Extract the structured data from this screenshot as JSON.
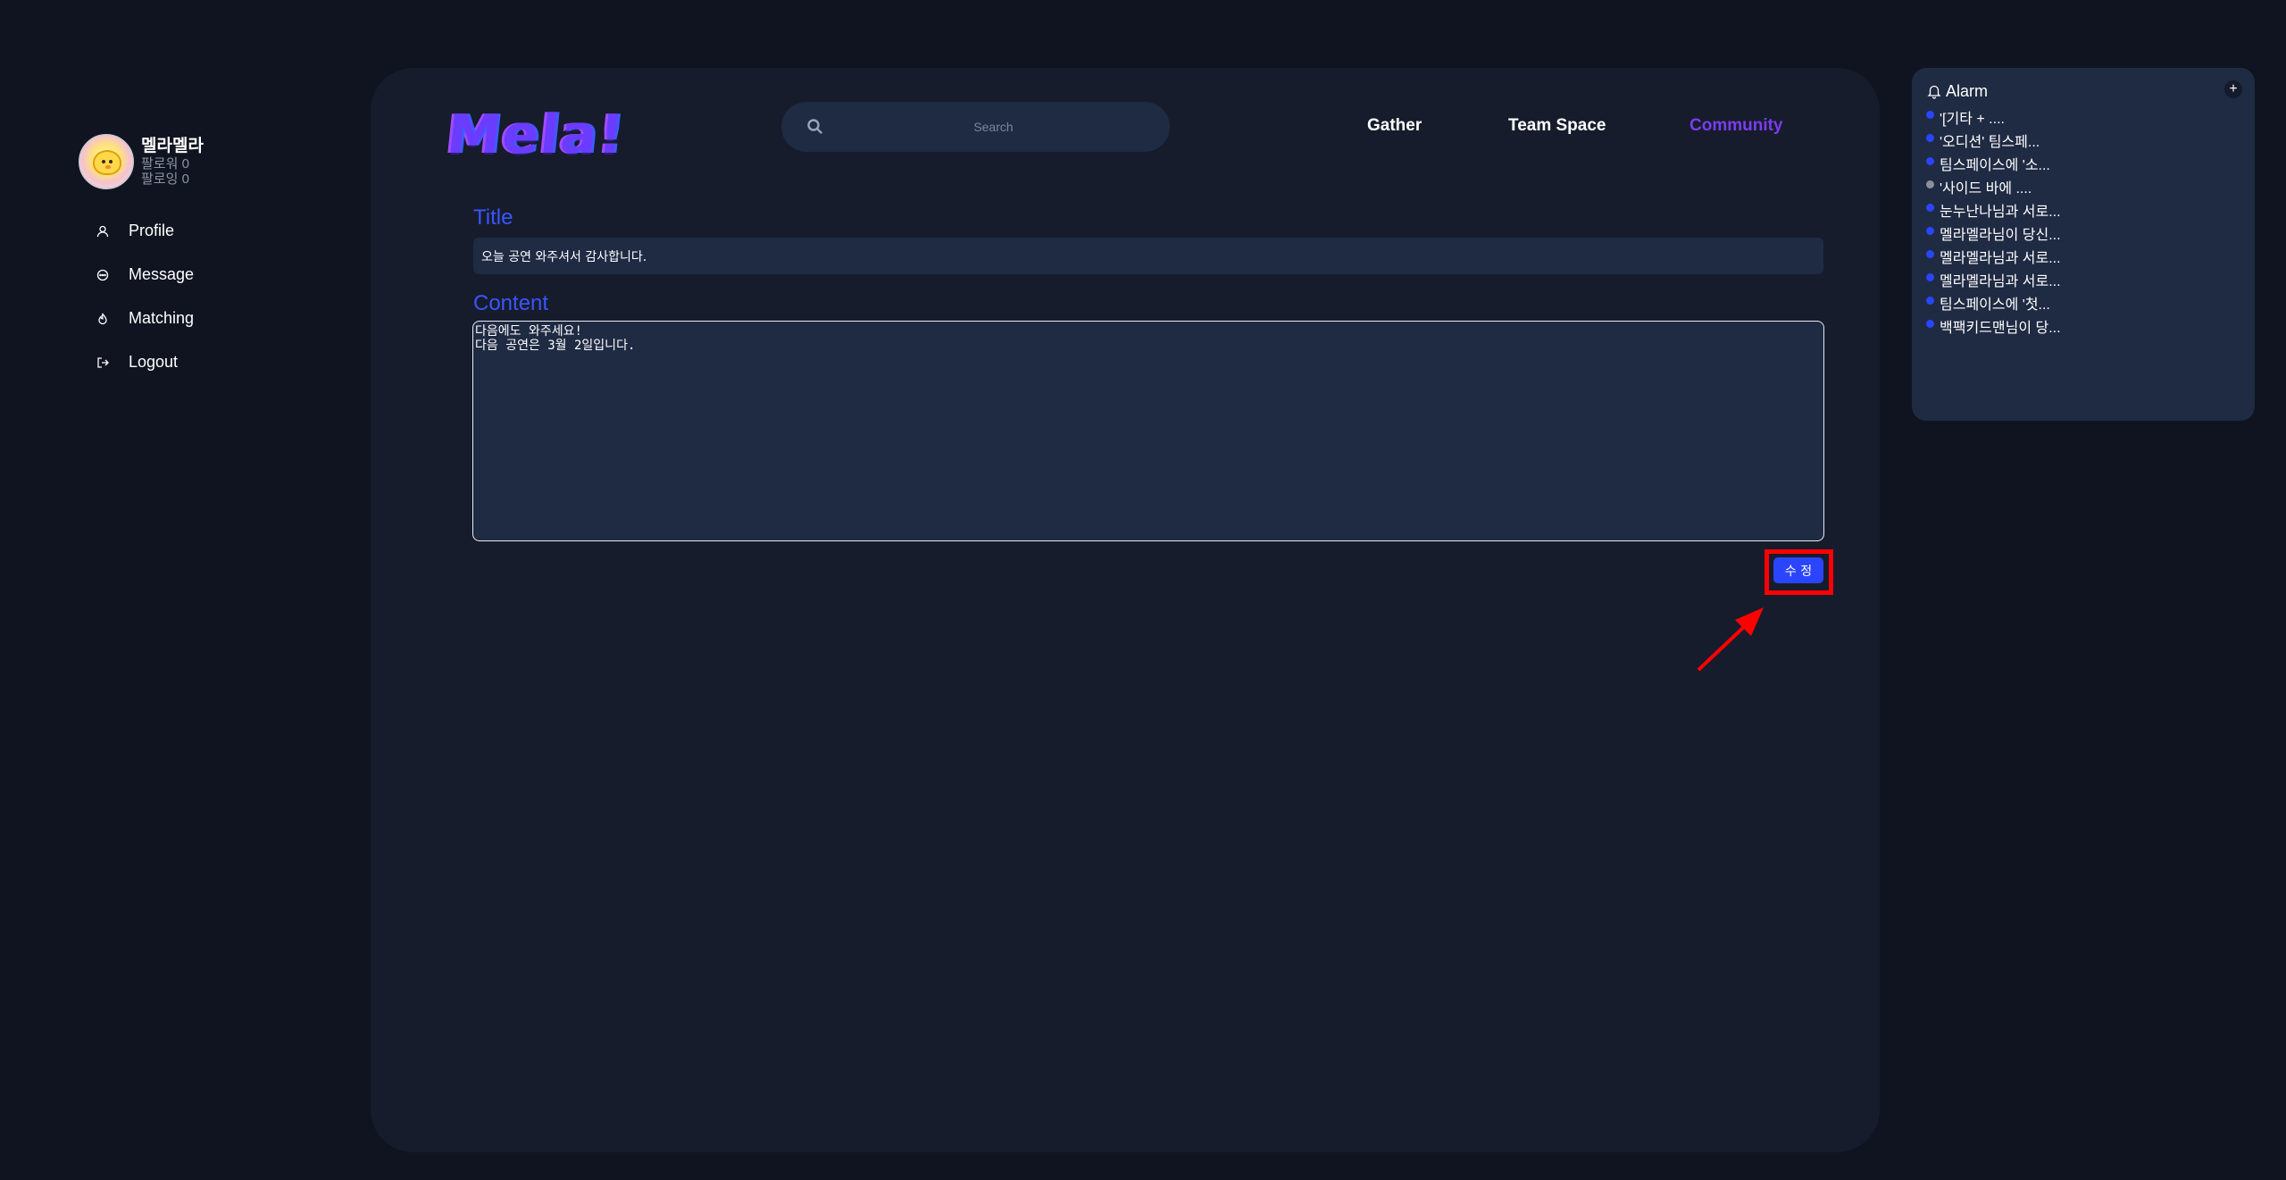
{
  "user": {
    "name": "멜라멜라",
    "followers": "팔로워 0",
    "following": "팔로잉 0"
  },
  "sidebar": {
    "items": [
      {
        "label": "Profile",
        "icon": "user-icon"
      },
      {
        "label": "Message",
        "icon": "message-icon"
      },
      {
        "label": "Matching",
        "icon": "matching-icon"
      },
      {
        "label": "Logout",
        "icon": "logout-icon"
      }
    ]
  },
  "header": {
    "logo": "Mela!",
    "search_placeholder": "Search",
    "nav": {
      "gather": "Gather",
      "team_space": "Team Space",
      "community": "Community"
    },
    "active_nav": "Community",
    "accent_color": "#7b3cf0"
  },
  "form": {
    "title_label": "Title",
    "title_value": "오늘 공연 와주셔서 감사합니다.",
    "content_label": "Content",
    "content_value": "다음에도 와주세요!\n다음 공연은 3월 2일입니다.",
    "submit_label": "수 정",
    "label_color": "#3a55ff",
    "button_color": "#2b45ff"
  },
  "alarm": {
    "title": "Alarm",
    "add_label": "+",
    "items": [
      {
        "text": "'[기타 + ....",
        "read": false
      },
      {
        "text": "'오디션' 팀스페...",
        "read": false
      },
      {
        "text": "팀스페이스에 '소...",
        "read": false
      },
      {
        "text": "'사이드 바에 ....",
        "read": true
      },
      {
        "text": "눈누난나님과 서로...",
        "read": false
      },
      {
        "text": "멜라멜라님이 당신...",
        "read": false
      },
      {
        "text": "멜라멜라님과 서로...",
        "read": false
      },
      {
        "text": "멜라멜라님과 서로...",
        "read": false
      },
      {
        "text": "팀스페이스에 '첫...",
        "read": false
      },
      {
        "text": "백팩키드맨님이 당...",
        "read": false
      }
    ],
    "unread_color": "#2b45ff",
    "read_color": "#8b8f99"
  }
}
